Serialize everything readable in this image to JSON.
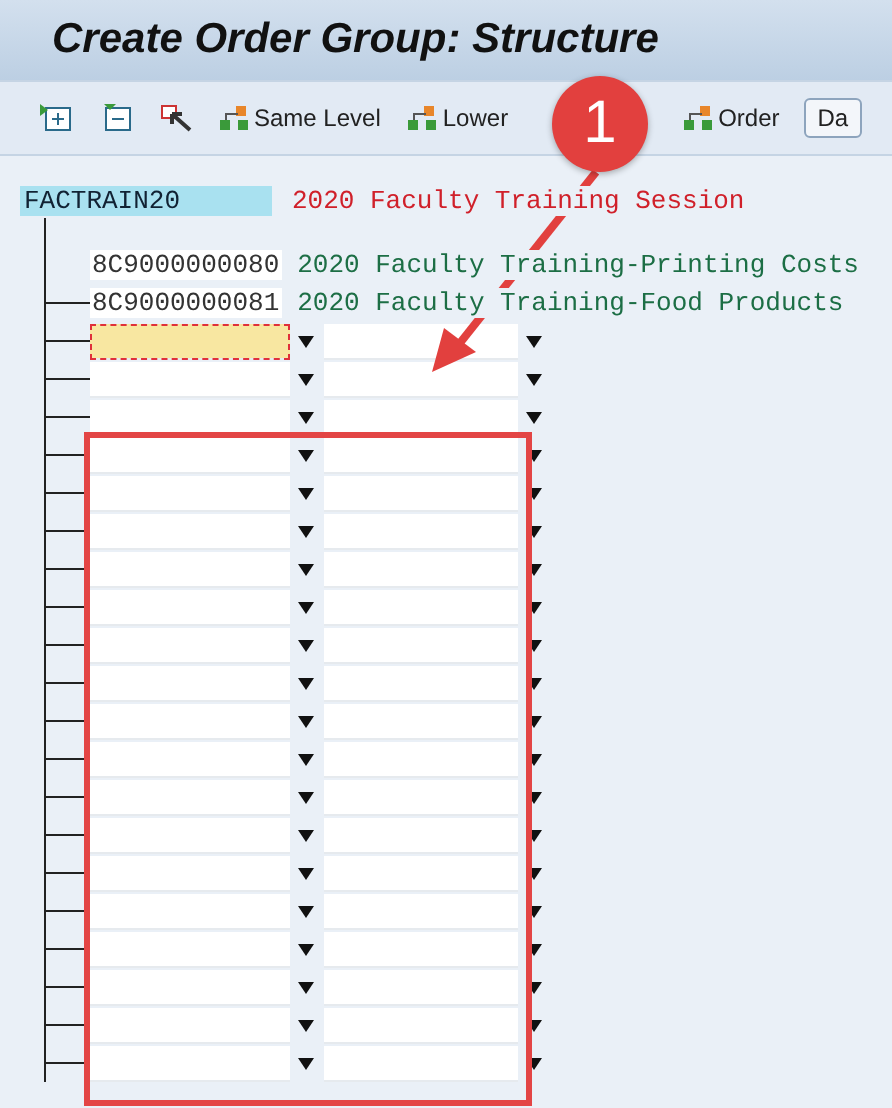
{
  "window": {
    "title": "Create Order Group: Structure"
  },
  "toolbar": [
    {
      "kind": "expand"
    },
    {
      "kind": "collapse"
    },
    {
      "kind": "select"
    },
    {
      "kind": "level",
      "label": "Same Level"
    },
    {
      "kind": "level",
      "label": "Lower"
    },
    {
      "kind": "level",
      "label": "Order"
    },
    {
      "kind": "framed",
      "label": "Da"
    }
  ],
  "root": {
    "id": "FACTRAIN20",
    "text": "2020 Faculty Training Session"
  },
  "children": [
    {
      "id": "8C9000000080",
      "text": "2020 Faculty Training-Printing Costs"
    },
    {
      "id": "8C9000000081",
      "text": "2020 Faculty Training-Food Products"
    }
  ],
  "entry_rows": [
    {
      "selected": true
    },
    {
      "selected": false
    },
    {
      "selected": false
    },
    {
      "selected": false
    },
    {
      "selected": false
    },
    {
      "selected": false
    },
    {
      "selected": false
    },
    {
      "selected": false
    },
    {
      "selected": false
    },
    {
      "selected": false
    },
    {
      "selected": false
    },
    {
      "selected": false
    },
    {
      "selected": false
    },
    {
      "selected": false
    },
    {
      "selected": false
    },
    {
      "selected": false
    },
    {
      "selected": false
    },
    {
      "selected": false
    },
    {
      "selected": false
    },
    {
      "selected": false
    }
  ],
  "callout": {
    "label": "1"
  }
}
